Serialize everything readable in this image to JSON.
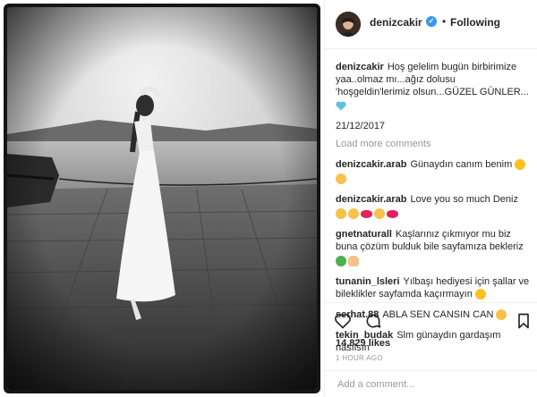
{
  "post": {
    "username": "denizcakir",
    "follow_status": "Following",
    "separator": "•",
    "caption_user": "denizcakir",
    "caption": "Hoş gelelim bugün birbirimize yaa..olmaz mı...ağız dolusu 'hoşgeldin'lerimiz olsun...GÜZEL GÜNLER...",
    "date": "21/12/2017",
    "load_more": "Load more comments",
    "likes": "14,829 likes",
    "time_ago": "1 HOUR AGO",
    "add_comment_placeholder": "Add a comment..."
  },
  "comments": [
    {
      "user": "denizcakir.arab",
      "text": "Günaydın canım benim"
    },
    {
      "user": "denizcakir.arab",
      "text": "Love you so much Deniz"
    },
    {
      "user": "gnetnaturall",
      "text": "Kaşlarınız çıkmıyor mu biz buna çözüm bulduk bile sayfamıza bekleriz"
    },
    {
      "user": "tunanin_lsleri",
      "text": "Yılbaşı hediyesi için şallar ve bileklikler sayfamda kaçırmayın"
    },
    {
      "user": "serhat.88",
      "text": "ABLA SEN CANSIN CAN"
    },
    {
      "user": "tekin_budak",
      "text": "Slm günaydın gardaşım nasılsın"
    }
  ],
  "icons": {
    "like": "heart-icon",
    "comment": "comment-icon",
    "save": "bookmark-icon",
    "verified": "verified-badge-icon"
  },
  "colors": {
    "verified": "#3897f0",
    "meta_gray": "#999999",
    "text": "#262626"
  }
}
